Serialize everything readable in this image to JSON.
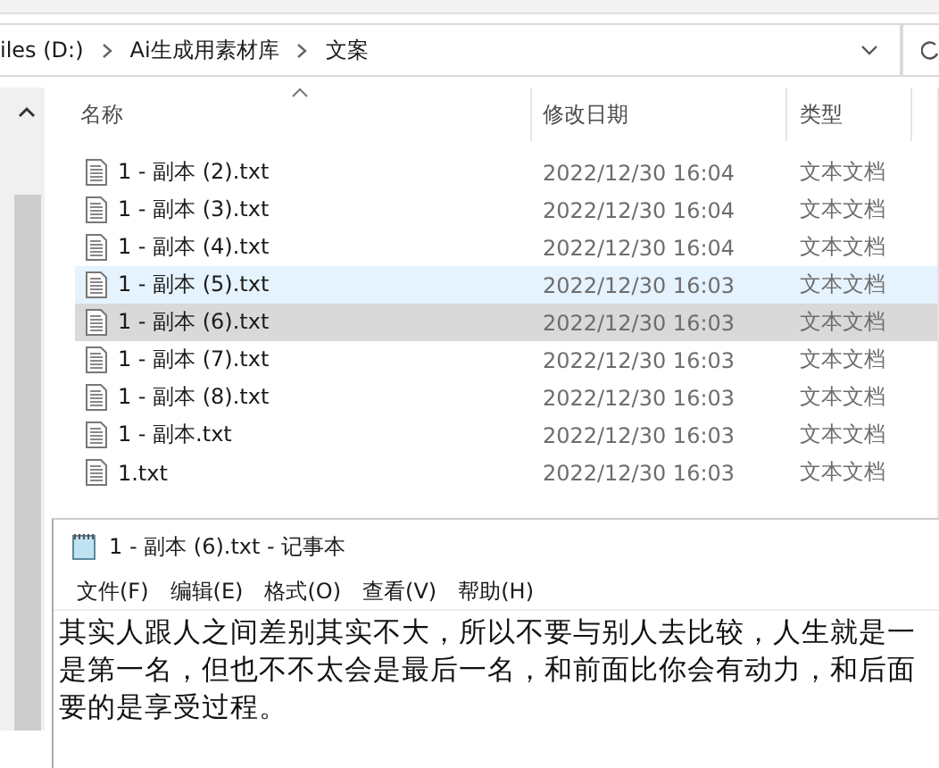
{
  "address_bar": {
    "path": [
      "iles (D:)",
      "Ai生成用素材库",
      "文案"
    ]
  },
  "columns": [
    "名称",
    "修改日期",
    "类型"
  ],
  "files": [
    {
      "name": "1 - 副本 (2).txt",
      "modified": "2022/12/30 16:04",
      "type": "文本文档",
      "hovered": false,
      "selected": false
    },
    {
      "name": "1 - 副本 (3).txt",
      "modified": "2022/12/30 16:04",
      "type": "文本文档",
      "hovered": false,
      "selected": false
    },
    {
      "name": "1 - 副本 (4).txt",
      "modified": "2022/12/30 16:04",
      "type": "文本文档",
      "hovered": false,
      "selected": false
    },
    {
      "name": "1 - 副本 (5).txt",
      "modified": "2022/12/30 16:03",
      "type": "文本文档",
      "hovered": true,
      "selected": false
    },
    {
      "name": "1 - 副本 (6).txt",
      "modified": "2022/12/30 16:03",
      "type": "文本文档",
      "hovered": false,
      "selected": true
    },
    {
      "name": "1 - 副本 (7).txt",
      "modified": "2022/12/30 16:03",
      "type": "文本文档",
      "hovered": false,
      "selected": false
    },
    {
      "name": "1 - 副本 (8).txt",
      "modified": "2022/12/30 16:03",
      "type": "文本文档",
      "hovered": false,
      "selected": false
    },
    {
      "name": "1 - 副本.txt",
      "modified": "2022/12/30 16:03",
      "type": "文本文档",
      "hovered": false,
      "selected": false
    },
    {
      "name": "1.txt",
      "modified": "2022/12/30 16:03",
      "type": "文本文档",
      "hovered": false,
      "selected": false
    }
  ],
  "notepad": {
    "title": "1 - 副本 (6).txt - 记事本",
    "menu": [
      "文件(F)",
      "编辑(E)",
      "格式(O)",
      "查看(V)",
      "帮助(H)"
    ],
    "lines": [
      "其实人跟人之间差别其实不大，所以不要与别人去比较，人生就是一",
      "是第一名，但也不不太会是最后一名，和前面比你会有动力，和后面",
      "要的是享受过程。"
    ]
  }
}
